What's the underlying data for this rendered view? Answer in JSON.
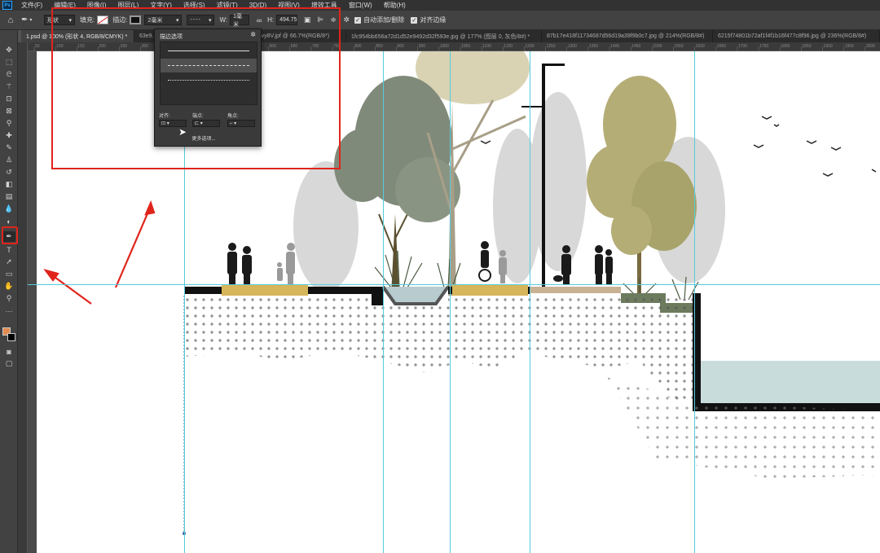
{
  "app": {
    "logo": "Ps"
  },
  "menu": [
    "文件(F)",
    "编辑(E)",
    "图像(I)",
    "图层(L)",
    "文字(Y)",
    "选择(S)",
    "滤镜(T)",
    "3D(D)",
    "视图(V)",
    "增效工具",
    "窗口(W)",
    "帮助(H)"
  ],
  "options": {
    "mode": "形状",
    "fill_label": "填充:",
    "stroke_label": "描边:",
    "stroke_width": "2毫米",
    "w_label": "W:",
    "w_value": "1毫米",
    "h_label": "H:",
    "h_value": "494.75",
    "auto_add_delete": "自动添加/删除",
    "align_edges": "对齐边缘"
  },
  "tabs": [
    "1.psd @ 100% (形状 4, RGB/8/CMYK) *",
    "63e9...",
    "34b76-kFvy8V.jpf @ 66.7%(RGB/8*)",
    "1fc954bb656a72d1d52e9492d32f593e.jpg @ 177% (图层 0, 灰色/8#) *",
    "87b17e418f11734687d56d19a39f9b0c7.jpg @ 214%(RGB/8#)",
    "6215f74801b72af1f4f1b16f477c8f96.jpg @ 236%(RGB/8#)"
  ],
  "ruler_ticks": [
    "50",
    "100",
    "150",
    "200",
    "250",
    "300",
    "350",
    "400",
    "450",
    "500",
    "550",
    "600",
    "650",
    "700",
    "750",
    "800",
    "850",
    "900",
    "950",
    "1000",
    "1050",
    "1100",
    "1150",
    "1200",
    "1250",
    "1300",
    "1350",
    "1400",
    "1450",
    "1500",
    "1550",
    "1600",
    "1650",
    "1700",
    "1750",
    "1800",
    "1850",
    "1900",
    "1950",
    "2000"
  ],
  "stroke_popup": {
    "title": "描边选项",
    "align_label": "对齐:",
    "caps_label": "端点:",
    "corners_label": "角点:",
    "more_button": "更多选项..."
  },
  "colors": {
    "foreground": "#e08a50",
    "background": "#000000",
    "guide": "#55ccdd",
    "highlight": "#e0241b"
  },
  "icons": [
    "home-icon",
    "pen-icon",
    "move-icon",
    "marquee-icon",
    "lasso-icon",
    "magic-wand-icon",
    "crop-icon",
    "frame-icon",
    "eyedropper-icon",
    "healing-icon",
    "brush-icon",
    "stamp-icon",
    "history-brush-icon",
    "eraser-icon",
    "gradient-icon",
    "blur-icon",
    "dodge-icon",
    "text-icon",
    "path-select-icon",
    "rectangle-icon",
    "hand-icon",
    "zoom-icon",
    "more-icon"
  ]
}
